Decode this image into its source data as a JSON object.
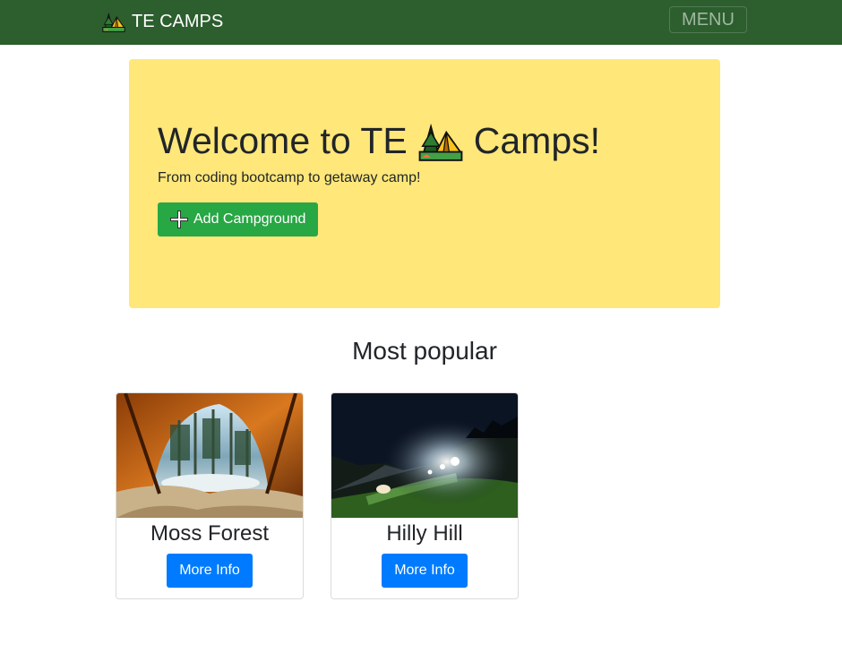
{
  "navbar": {
    "brand_label": "TE CAMPS",
    "brand_icon": "camping-tent-icon",
    "menu_label": "MENU",
    "background": "#2c5e2e"
  },
  "jumbotron": {
    "title_before": "Welcome to TE",
    "title_icon": "camping-tent-icon",
    "title_after": "Camps!",
    "subtitle": "From coding bootcamp to getaway camp!",
    "add_button_label": "Add Campground",
    "add_button_icon": "plus-icon",
    "background": "#ffe77a"
  },
  "popular": {
    "heading": "Most popular",
    "cards": [
      {
        "title": "Moss Forest",
        "button_label": "More Info",
        "image": "tent-interior-forest-photo"
      },
      {
        "title": "Hilly Hill",
        "button_label": "More Info",
        "image": "night-hill-camp-photo"
      }
    ]
  },
  "colors": {
    "success": "#28a745",
    "primary": "#007bff"
  }
}
